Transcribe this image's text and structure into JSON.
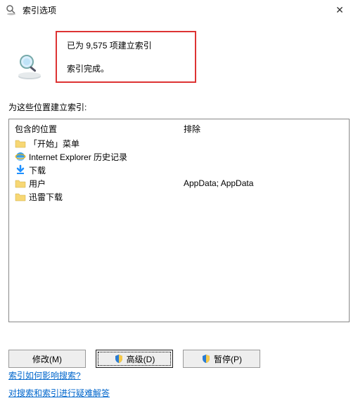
{
  "titlebar": {
    "title": "索引选项"
  },
  "status": {
    "line1": "已为 9,575 项建立索引",
    "line2": "索引完成。"
  },
  "section_label": "为这些位置建立索引:",
  "columns": {
    "included": "包含的位置",
    "excluded": "排除"
  },
  "rows": [
    {
      "icon": "folder",
      "name": "「开始」菜单",
      "excluded": ""
    },
    {
      "icon": "ie",
      "name": "Internet Explorer 历史记录",
      "excluded": ""
    },
    {
      "icon": "download",
      "name": "下载",
      "excluded": ""
    },
    {
      "icon": "folder",
      "name": "用户",
      "excluded": "AppData; AppData"
    },
    {
      "icon": "folder",
      "name": "迅雷下载",
      "excluded": ""
    }
  ],
  "buttons": {
    "modify": "修改(M)",
    "advanced": "高级(D)",
    "pause": "暂停(P)"
  },
  "links": {
    "help": "索引如何影响搜索?",
    "troubleshoot": "对搜索和索引进行疑难解答"
  }
}
